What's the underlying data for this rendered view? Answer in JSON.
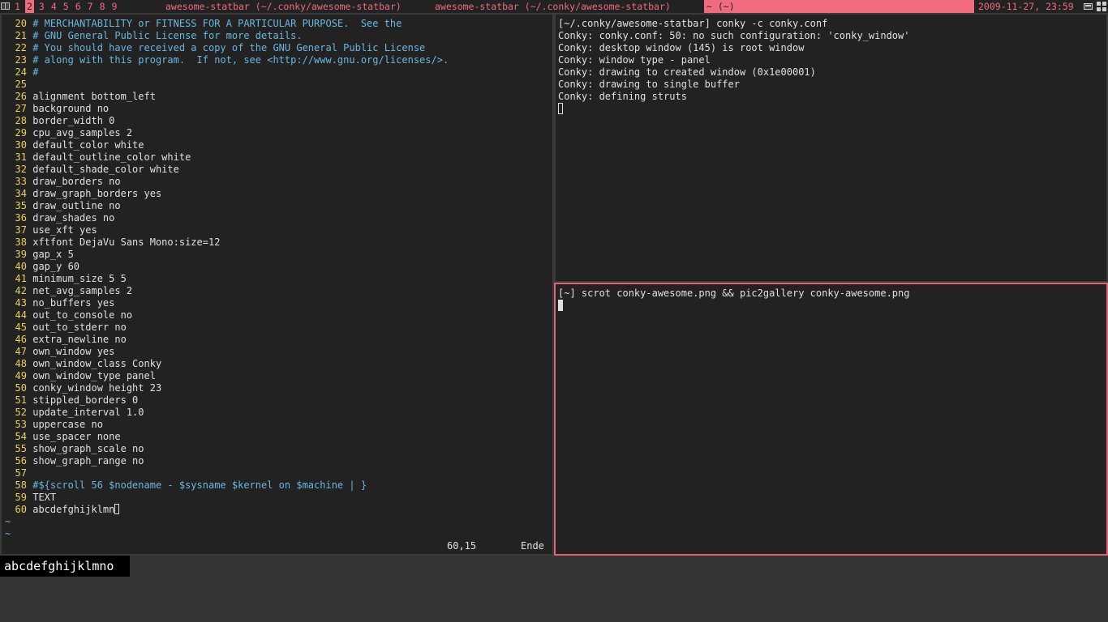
{
  "topbar": {
    "tags": [
      {
        "label": "1",
        "sup": "",
        "active": false
      },
      {
        "label": "2",
        "sup": "",
        "active": true
      },
      {
        "label": "3",
        "sup": "",
        "active": false
      },
      {
        "label": "4",
        "sup": "",
        "active": false
      },
      {
        "label": "5",
        "sup": "",
        "active": false
      },
      {
        "label": "6",
        "sup": "",
        "active": false
      },
      {
        "label": "7",
        "sup": "",
        "active": false
      },
      {
        "label": "8",
        "sup": "",
        "active": false
      },
      {
        "label": "9",
        "sup": "",
        "active": false
      }
    ],
    "tasks": [
      "awesome-statbar (~/.conky/awesome-statbar)",
      "awesome-statbar (~/.conky/awesome-statbar)",
      "~ (~)"
    ],
    "clock": "2009-11-27, 23:59",
    "accent": "#f06a80"
  },
  "vim": {
    "lines": [
      {
        "n": "20",
        "t": "# MERCHANTABILITY or FITNESS FOR A PARTICULAR PURPOSE.  See the",
        "comment": true
      },
      {
        "n": "21",
        "t": "# GNU General Public License for more details.",
        "comment": true
      },
      {
        "n": "22",
        "t": "# You should have received a copy of the GNU General Public License",
        "comment": true
      },
      {
        "n": "23",
        "t": "# along with this program.  If not, see <http://www.gnu.org/licenses/>.",
        "comment": true
      },
      {
        "n": "24",
        "t": "#",
        "comment": true
      },
      {
        "n": "25",
        "t": "",
        "comment": false
      },
      {
        "n": "26",
        "t": "alignment bottom_left",
        "comment": false
      },
      {
        "n": "27",
        "t": "background no",
        "comment": false
      },
      {
        "n": "28",
        "t": "border_width 0",
        "comment": false
      },
      {
        "n": "29",
        "t": "cpu_avg_samples 2",
        "comment": false
      },
      {
        "n": "30",
        "t": "default_color white",
        "comment": false
      },
      {
        "n": "31",
        "t": "default_outline_color white",
        "comment": false
      },
      {
        "n": "32",
        "t": "default_shade_color white",
        "comment": false
      },
      {
        "n": "33",
        "t": "draw_borders no",
        "comment": false
      },
      {
        "n": "34",
        "t": "draw_graph_borders yes",
        "comment": false
      },
      {
        "n": "35",
        "t": "draw_outline no",
        "comment": false
      },
      {
        "n": "36",
        "t": "draw_shades no",
        "comment": false
      },
      {
        "n": "37",
        "t": "use_xft yes",
        "comment": false
      },
      {
        "n": "38",
        "t": "xftfont DejaVu Sans Mono:size=12",
        "comment": false
      },
      {
        "n": "39",
        "t": "gap_x 5",
        "comment": false
      },
      {
        "n": "40",
        "t": "gap_y 60",
        "comment": false
      },
      {
        "n": "41",
        "t": "minimum_size 5 5",
        "comment": false
      },
      {
        "n": "42",
        "t": "net_avg_samples 2",
        "comment": false
      },
      {
        "n": "43",
        "t": "no_buffers yes",
        "comment": false
      },
      {
        "n": "44",
        "t": "out_to_console no",
        "comment": false
      },
      {
        "n": "45",
        "t": "out_to_stderr no",
        "comment": false
      },
      {
        "n": "46",
        "t": "extra_newline no",
        "comment": false
      },
      {
        "n": "47",
        "t": "own_window yes",
        "comment": false
      },
      {
        "n": "48",
        "t": "own_window_class Conky",
        "comment": false
      },
      {
        "n": "49",
        "t": "own_window_type panel",
        "comment": false
      },
      {
        "n": "50",
        "t": "conky_window height 23",
        "comment": false
      },
      {
        "n": "51",
        "t": "stippled_borders 0",
        "comment": false
      },
      {
        "n": "52",
        "t": "update_interval 1.0",
        "comment": false
      },
      {
        "n": "53",
        "t": "uppercase no",
        "comment": false
      },
      {
        "n": "54",
        "t": "use_spacer none",
        "comment": false
      },
      {
        "n": "55",
        "t": "show_graph_scale no",
        "comment": false
      },
      {
        "n": "56",
        "t": "show_graph_range no",
        "comment": false
      },
      {
        "n": "57",
        "t": "",
        "comment": false
      },
      {
        "n": "58",
        "t": "#${scroll 56 $nodename - $sysname $kernel on $machine | }",
        "comment": true
      },
      {
        "n": "59",
        "t": "TEXT",
        "comment": false
      },
      {
        "n": "60",
        "t": "abcdefghijklmn",
        "comment": false,
        "cursor": true
      }
    ],
    "tildes": [
      "~",
      "~"
    ],
    "cursor_pos": "60,15",
    "scroll_pos": "Ende"
  },
  "term1": {
    "lines": [
      "[~/.conky/awesome-statbar] conky -c conky.conf",
      "Conky: conky.conf: 50: no such configuration: 'conky_window'",
      "Conky: desktop window (145) is root window",
      "Conky: window type - panel",
      "Conky: drawing to created window (0x1e00001)",
      "Conky: drawing to single buffer",
      "Conky: defining struts"
    ]
  },
  "term2": {
    "lines": [
      "[~] scrot conky-awesome.png && pic2gallery conky-awesome.png"
    ]
  },
  "conky": {
    "text": "abcdefghijklmno"
  }
}
